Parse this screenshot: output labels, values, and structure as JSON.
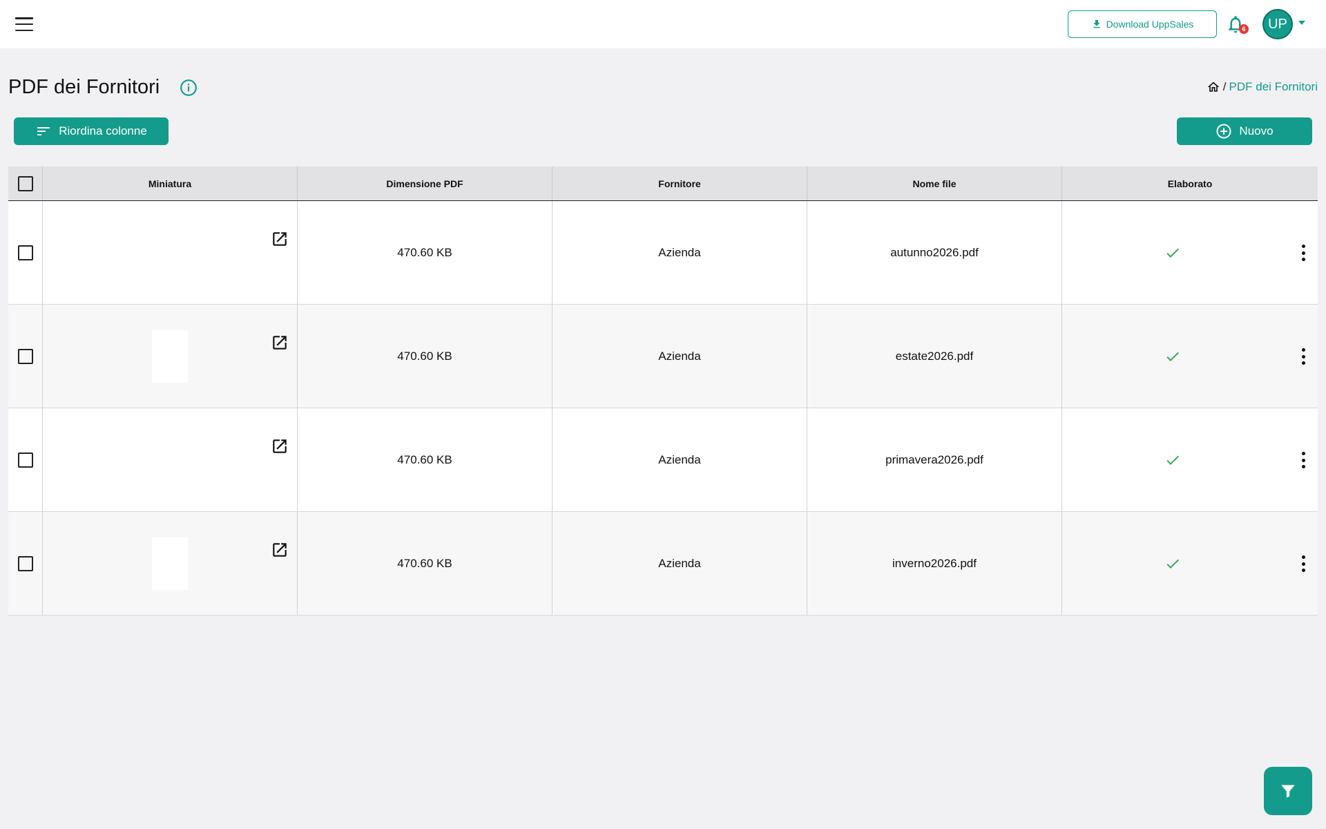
{
  "header": {
    "download_label": "Download UppSales",
    "notifications_count": "6",
    "avatar_initials": "UP"
  },
  "page": {
    "title": "PDF dei Fornitori",
    "breadcrumb_current": "PDF dei Fornitori"
  },
  "toolbar": {
    "reorder_label": "Riordina colonne",
    "new_label": "Nuovo"
  },
  "table": {
    "columns": [
      "Miniatura",
      "Dimensione PDF",
      "Fornitore",
      "Nome file",
      "Elaborato"
    ],
    "rows": [
      {
        "size": "470.60 KB",
        "supplier": "Azienda",
        "filename": "autunno2026.pdf",
        "processed": true
      },
      {
        "size": "470.60 KB",
        "supplier": "Azienda",
        "filename": "estate2026.pdf",
        "processed": true
      },
      {
        "size": "470.60 KB",
        "supplier": "Azienda",
        "filename": "primavera2026.pdf",
        "processed": true
      },
      {
        "size": "470.60 KB",
        "supplier": "Azienda",
        "filename": "inverno2026.pdf",
        "processed": true
      }
    ]
  },
  "colors": {
    "accent": "#139c8c",
    "check_green": "#3aa852",
    "badge_red": "#e53935"
  },
  "icons": {
    "menu": "hamburger-icon",
    "download": "download-icon",
    "notifications": "bell-icon",
    "info": "info-icon",
    "home": "home-icon",
    "reorder": "sort-icon",
    "new": "plus-circle-icon",
    "open": "open-external-icon",
    "processed": "check-icon",
    "row_menu": "more-vertical-icon",
    "filter": "filter-icon"
  }
}
